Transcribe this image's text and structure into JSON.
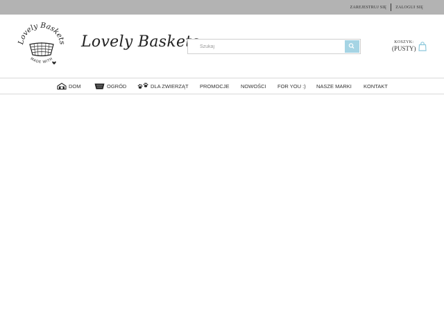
{
  "topbar": {
    "register_label": "ZAREJESTRUJ SIĘ",
    "login_label": "ZALOGUJ SIĘ"
  },
  "logo": {
    "badge_top_text": "Lovely Baskets",
    "badge_bottom_text": "MADE WITH",
    "brand_name": "Lovely Baskets"
  },
  "search": {
    "placeholder": "Szukaj",
    "value": ""
  },
  "cart": {
    "label": "KOSZYK:",
    "status": "(PUSTY)"
  },
  "nav": {
    "items": [
      {
        "label": "DOM",
        "icon": "house-icon"
      },
      {
        "label": "OGRÓD",
        "icon": "basket-icon"
      },
      {
        "label": "DLA ZWIERZĄT",
        "icon": "paw-icon"
      },
      {
        "label": "PROMOCJE"
      },
      {
        "label": "NOWOŚCI"
      },
      {
        "label": "FOR YOU :)"
      },
      {
        "label": "NASZE MARKI"
      },
      {
        "label": "KONTAKT"
      }
    ]
  },
  "colors": {
    "topbar": "#b3b3b3",
    "accent": "#a5d4e4",
    "text": "#333333"
  }
}
